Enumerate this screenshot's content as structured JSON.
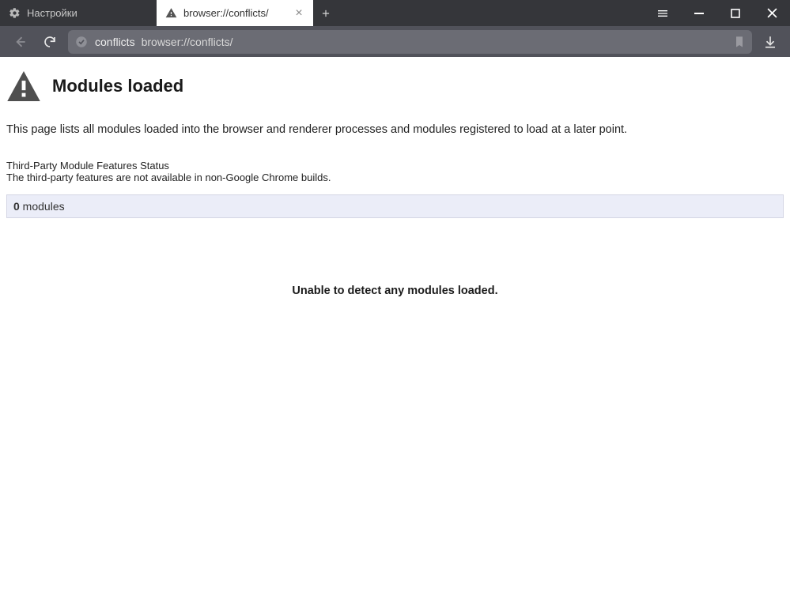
{
  "tabs": {
    "inactive": {
      "label": "Настройки"
    },
    "active": {
      "label": "browser://conflicts/"
    }
  },
  "addressbar": {
    "chip": "conflicts",
    "url": "browser://conflicts/"
  },
  "page": {
    "title": "Modules loaded",
    "description": "This page lists all modules loaded into the browser and renderer processes and modules registered to load at a later point.",
    "tpm_title": "Third-Party Module Features Status",
    "tpm_desc": "The third-party features are not available in non-Google Chrome builds.",
    "module_count": "0",
    "module_label": " modules",
    "empty": "Unable to detect any modules loaded."
  }
}
